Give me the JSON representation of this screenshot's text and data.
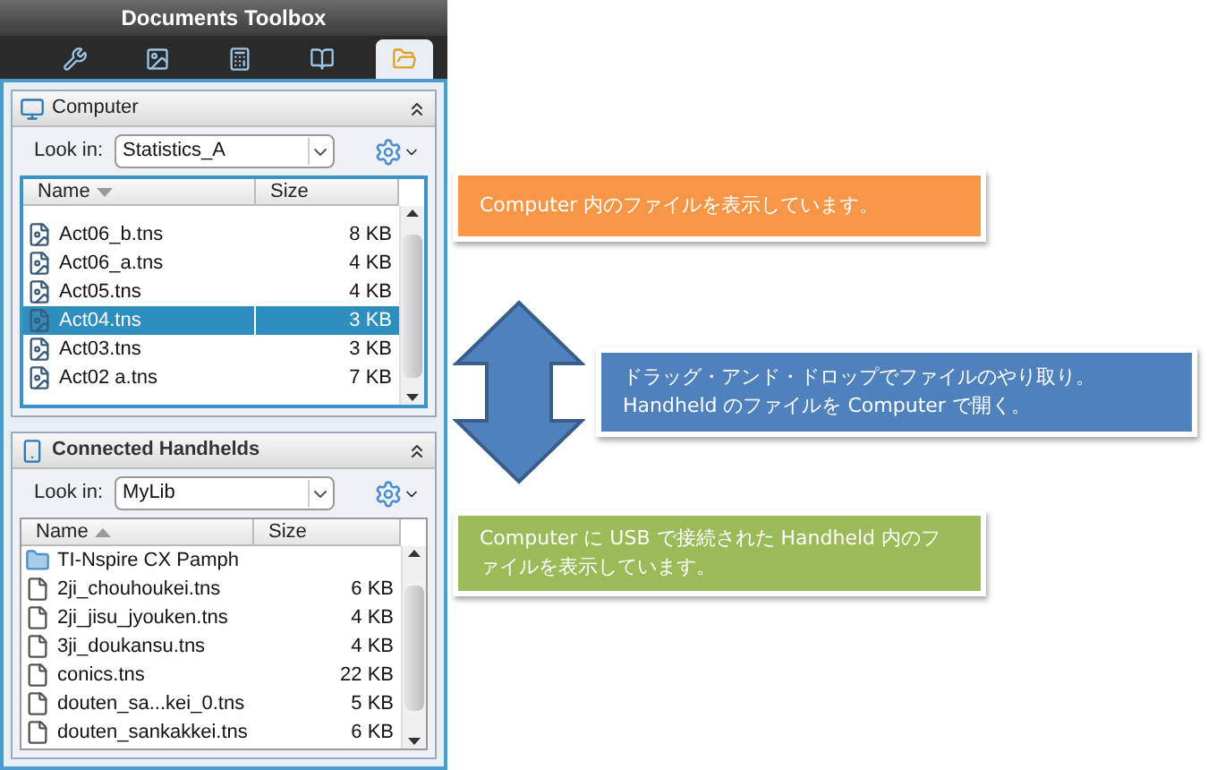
{
  "window": {
    "title": "Documents Toolbox"
  },
  "tabs": [
    {
      "selected": false
    },
    {
      "selected": false
    },
    {
      "selected": false
    },
    {
      "selected": false
    },
    {
      "selected": true
    }
  ],
  "panels": [
    {
      "kind": "computer",
      "title": "Computer",
      "look_in_label": "Look in:",
      "look_in": "Statistics_A",
      "focused": true,
      "columns": [
        {
          "label": "Name",
          "sorted": true,
          "descending": true
        },
        {
          "label": "Size",
          "sorted": false
        }
      ],
      "rows": [
        {
          "kind": "tns",
          "name": "Act06_b.tns",
          "size": "8 KB",
          "selected": false
        },
        {
          "kind": "tns",
          "name": "Act06_a.tns",
          "size": "4 KB",
          "selected": false
        },
        {
          "kind": "tns",
          "name": "Act05.tns",
          "size": "4 KB",
          "selected": false
        },
        {
          "kind": "tns",
          "name": "Act04.tns",
          "size": "3 KB",
          "selected": true
        },
        {
          "kind": "tns",
          "name": "Act03.tns",
          "size": "3 KB",
          "selected": false
        },
        {
          "kind": "tns",
          "name": "Act02 a.tns",
          "size": "7 KB",
          "selected": false
        }
      ]
    },
    {
      "kind": "handheld",
      "title": "Connected Handhelds",
      "look_in_label": "Look in:",
      "look_in": "MyLib",
      "focused": false,
      "columns": [
        {
          "label": "Name",
          "sorted": true,
          "descending": false
        },
        {
          "label": "Size",
          "sorted": false
        }
      ],
      "rows": [
        {
          "kind": "folder",
          "name": "TI-Nspire CX Pamph",
          "selected": false
        },
        {
          "kind": "file",
          "name": "2ji_chouhoukei.tns",
          "size": "6 KB",
          "selected": false
        },
        {
          "kind": "file",
          "name": "2ji_jisu_jyouken.tns",
          "size": "4 KB",
          "selected": false
        },
        {
          "kind": "file",
          "name": "3ji_doukansu.tns",
          "size": "4 KB",
          "selected": false
        },
        {
          "kind": "file",
          "name": "conics.tns",
          "size": "22 KB",
          "selected": false
        },
        {
          "kind": "file",
          "name": "douten_sa...kei_0.tns",
          "size": "5 KB",
          "selected": false
        },
        {
          "kind": "file",
          "name": "douten_sankakkei.tns",
          "size": "6 KB",
          "selected": false
        }
      ]
    }
  ],
  "callouts": [
    {
      "text": "Computer 内のファイルを表示しています。",
      "color": "#f79646"
    },
    {
      "text": "ドラッグ・アンド・ドロップでファイルのやり取り。\nHandheld のファイルを Computer で開く。",
      "color": "#4f81bd"
    },
    {
      "text": "Computer に USB で接続された Handheld 内のファイルを表示しています。",
      "color": "#9bbb59"
    }
  ]
}
